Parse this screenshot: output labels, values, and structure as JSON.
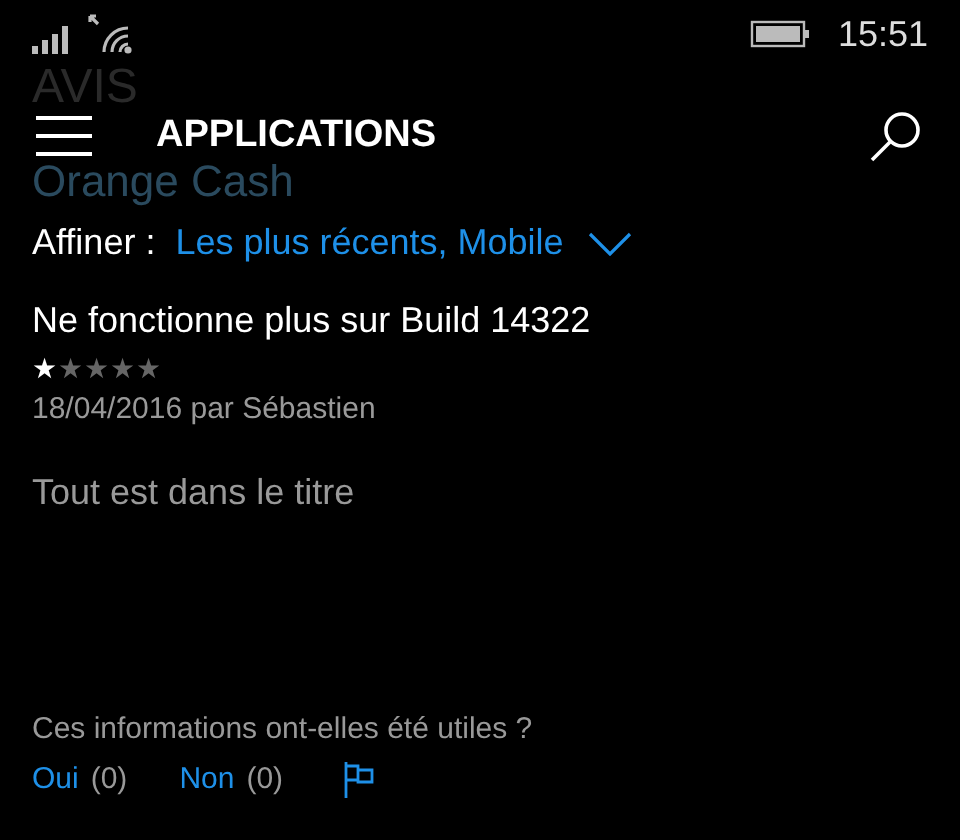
{
  "status_bar": {
    "time": "15:51"
  },
  "background_titles": {
    "section": "AVIS",
    "app": "Orange Cash"
  },
  "header": {
    "title": "APPLICATIONS"
  },
  "filter": {
    "label": "Affiner :",
    "value": "Les plus récents, Mobile"
  },
  "review": {
    "title": "Ne fonctionne plus sur Build 14322",
    "stars": 1,
    "meta": "18/04/2016 par Sébastien",
    "body": "Tout est dans le titre"
  },
  "feedback": {
    "question": "Ces informations ont-elles été utiles ?",
    "votes": [
      {
        "label": "Oui",
        "count": "(0)"
      },
      {
        "label": "Non",
        "count": "(0)"
      }
    ]
  }
}
